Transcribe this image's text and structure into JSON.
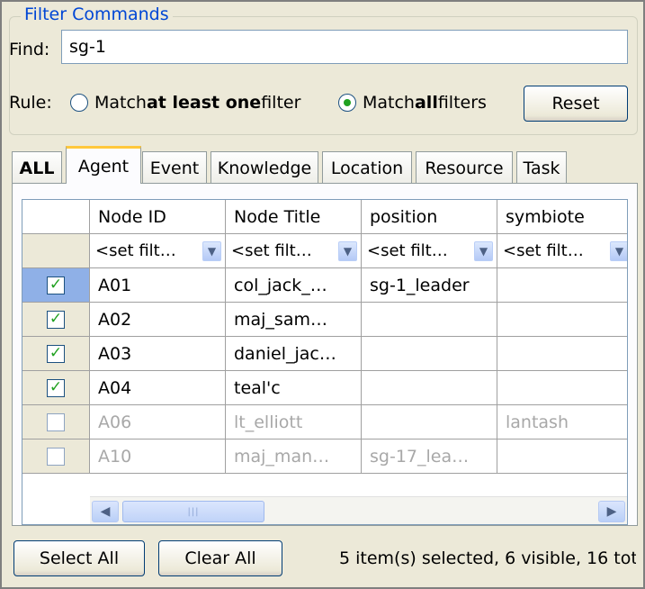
{
  "filter_group": {
    "title": "Filter Commands",
    "find_label": "Find:",
    "find_value": "sg-1",
    "rule_label": "Rule:",
    "rule_option_1": {
      "pre": "Match ",
      "bold": "at least one",
      "post": " filter",
      "selected": false
    },
    "rule_option_2": {
      "pre": "Match ",
      "bold": "all",
      "post": " filters",
      "selected": true
    },
    "reset_label": "Reset"
  },
  "tabs": [
    {
      "label": "ALL",
      "active": false
    },
    {
      "label": "Agent",
      "active": true
    },
    {
      "label": "Event",
      "active": false
    },
    {
      "label": "Knowledge",
      "active": false
    },
    {
      "label": "Location",
      "active": false
    },
    {
      "label": "Resource",
      "active": false
    },
    {
      "label": "Task",
      "active": false
    }
  ],
  "table": {
    "columns": [
      "Node ID",
      "Node Title",
      "position",
      "symbiote"
    ],
    "filter_placeholder": "<set filt…",
    "rows": [
      {
        "checked": true,
        "selected": true,
        "dim": false,
        "cells": [
          "A01",
          "col_jack_…",
          "sg-1_leader",
          ""
        ]
      },
      {
        "checked": true,
        "selected": false,
        "dim": false,
        "cells": [
          "A02",
          "maj_sam…",
          "",
          ""
        ]
      },
      {
        "checked": true,
        "selected": false,
        "dim": false,
        "cells": [
          "A03",
          "daniel_jac…",
          "",
          ""
        ]
      },
      {
        "checked": true,
        "selected": false,
        "dim": false,
        "cells": [
          "A04",
          "teal'c",
          "",
          ""
        ]
      },
      {
        "checked": false,
        "selected": false,
        "dim": true,
        "cells": [
          "A06",
          "lt_elliott",
          "",
          "lantash"
        ]
      },
      {
        "checked": false,
        "selected": false,
        "dim": true,
        "cells": [
          "A10",
          "maj_man…",
          "sg-17_lea…",
          ""
        ]
      }
    ]
  },
  "footer": {
    "select_all_label": "Select All",
    "clear_all_label": "Clear All",
    "status_text": "5 item(s) selected, 6 visible, 16 tot"
  },
  "colors": {
    "group_title": "#0046d5",
    "check_mark": "#21a121",
    "active_tab_accent": "#ffc83c",
    "selected_row_header": "#8fb0e7"
  }
}
